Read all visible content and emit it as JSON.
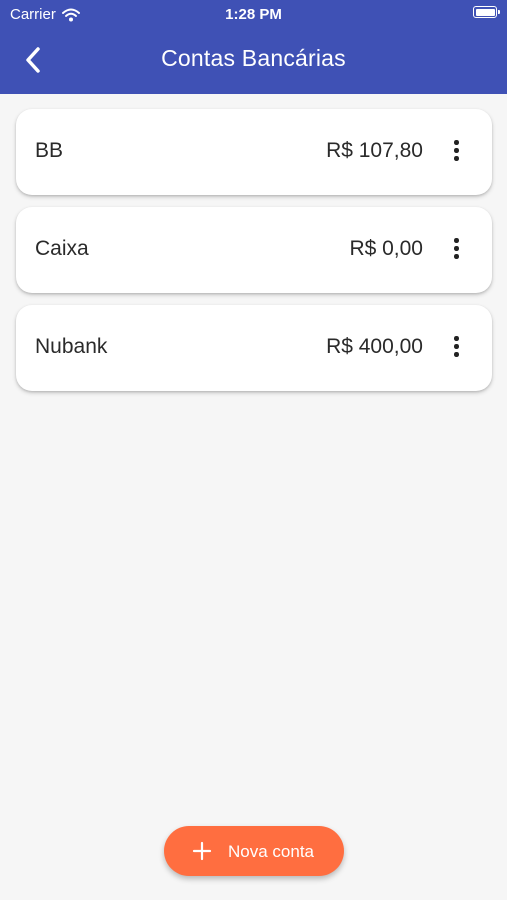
{
  "status_bar": {
    "carrier": "Carrier",
    "time": "1:28 PM",
    "wifi_icon": "wifi-icon",
    "battery_icon": "battery-icon"
  },
  "header": {
    "title": "Contas Bancárias",
    "back_icon": "chevron-left-icon",
    "background": "#3f51b5"
  },
  "accounts": [
    {
      "name": "BB",
      "amount": "R$ 107,80",
      "menu_icon": "more-vert-icon"
    },
    {
      "name": "Caixa",
      "amount": "R$ 0,00",
      "menu_icon": "more-vert-icon"
    },
    {
      "name": "Nubank",
      "amount": "R$ 400,00",
      "menu_icon": "more-vert-icon"
    }
  ],
  "fab": {
    "label": "Nova conta",
    "icon": "plus-icon",
    "color": "#ff6e40"
  },
  "colors": {
    "page_background": "#f6f6f6",
    "card_background": "#ffffff",
    "text": "#2a2a2a"
  }
}
